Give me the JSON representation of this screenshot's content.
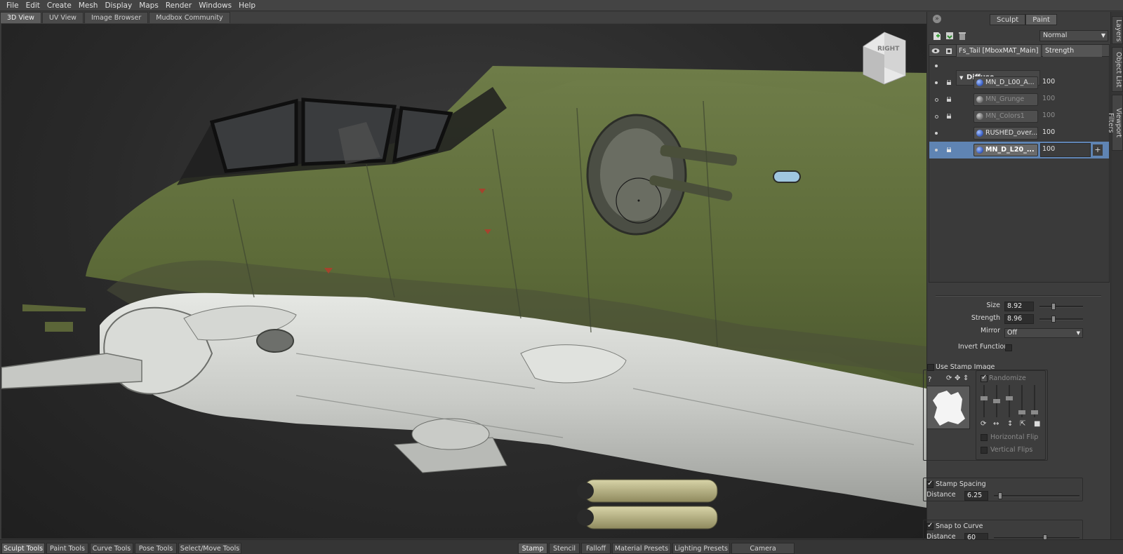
{
  "menu": [
    "File",
    "Edit",
    "Create",
    "Mesh",
    "Display",
    "Maps",
    "Render",
    "Windows",
    "Help"
  ],
  "view_tabs": [
    {
      "label": "3D View",
      "active": true
    },
    {
      "label": "UV View",
      "active": false
    },
    {
      "label": "Image Browser",
      "active": false
    },
    {
      "label": "Mudbox Community",
      "active": false
    }
  ],
  "viewcube": {
    "face_label": "RIGHT"
  },
  "mode_tabs": [
    {
      "label": "Sculpt",
      "active": false
    },
    {
      "label": "Paint",
      "active": true
    }
  ],
  "side_tabs": [
    "Layers",
    "Object List",
    "Viewport Filters"
  ],
  "layers": {
    "blend_mode": "Normal",
    "header_name": "Fs_Tail [MboxMAT_Main]",
    "header_strength": "Strength",
    "group": "Diffuse",
    "rows": [
      {
        "name": "MN_D_L00_A...",
        "value": "100",
        "visible": true,
        "dim": false
      },
      {
        "name": "MN_Grunge",
        "value": "100",
        "visible": false,
        "dim": true
      },
      {
        "name": "MN_Colors1",
        "value": "100",
        "visible": false,
        "dim": true
      },
      {
        "name": "RUSHED_over...",
        "value": "100",
        "visible": true,
        "dim": false
      },
      {
        "name": "MN_D_L20_...",
        "value": "100",
        "visible": true,
        "dim": false,
        "selected": true
      }
    ]
  },
  "properties": {
    "size_label": "Size",
    "size_value": "8.92",
    "size_level": 0.3,
    "strength_label": "Strength",
    "strength_value": "8.96",
    "strength_level": 0.3,
    "mirror_label": "Mirror",
    "mirror_value": "Off",
    "invert_label": "Invert Function",
    "use_stamp_label": "Use Stamp Image",
    "randomize_label": "Randomize",
    "hflip_label": "Horizontal Flip",
    "vflip_label": "Vertical Flips",
    "stamp_spacing_label": "Stamp Spacing",
    "distance_label": "Distance",
    "distance_value": "6.25",
    "distance_level": 0.05,
    "snap_label": "Snap to Curve",
    "snap_distance_label": "Distance",
    "snap_distance_value": "60",
    "snap_distance_level": 0.6
  },
  "bottom_left_tabs": [
    {
      "label": "Sculpt Tools",
      "active": true
    },
    {
      "label": "Paint Tools",
      "active": false
    },
    {
      "label": "Curve Tools",
      "active": false
    },
    {
      "label": "Pose Tools",
      "active": false
    },
    {
      "label": "Select/Move Tools",
      "active": false
    }
  ],
  "bottom_right_tabs": [
    {
      "label": "Stamp",
      "active": true
    },
    {
      "label": "Stencil",
      "active": false
    },
    {
      "label": "Falloff",
      "active": false
    },
    {
      "label": "Material Presets",
      "active": false
    },
    {
      "label": "Lighting Presets",
      "active": false
    },
    {
      "label": "Camera Bookmarks",
      "active": false
    }
  ],
  "colors": {
    "hull_green": "#5f6d3b",
    "hull_white": "#cfd1ce",
    "selection_blue": "#5f84b3",
    "panel_bg": "#3d3d3d"
  }
}
